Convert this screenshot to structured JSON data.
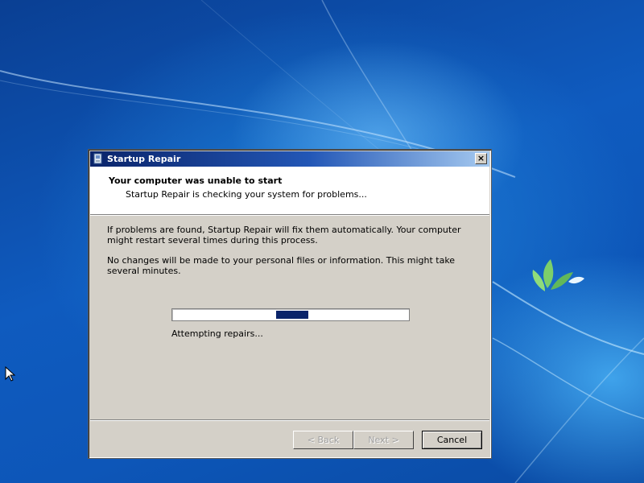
{
  "window": {
    "title": "Startup Repair",
    "close_label": "×"
  },
  "header": {
    "heading": "Your computer was unable to start",
    "subheading": "Startup Repair is checking your system for problems..."
  },
  "body": {
    "paragraph1": "If problems are found, Startup Repair will fix them automatically. Your computer might restart several times during this process.",
    "paragraph2": "No changes will be made to your personal files or information. This might take several minutes."
  },
  "progress": {
    "status": "Attempting repairs...",
    "indeterminate": true,
    "block_start_fraction": 0.44,
    "block_width_fraction": 0.135
  },
  "buttons": {
    "back_label": "< Back",
    "next_label": "Next >",
    "cancel_label": "Cancel"
  },
  "colors": {
    "titlebar_start": "#0a246a",
    "titlebar_end": "#a6caf0",
    "dialog_face": "#d4d0c8",
    "progress_block": "#0a246a",
    "desktop_blue": "#0f5bbf"
  },
  "icons": {
    "title_icon": "system-repair-icon",
    "cursor": "mouse-pointer-icon",
    "logo": "windows-fish-logo-icon"
  }
}
